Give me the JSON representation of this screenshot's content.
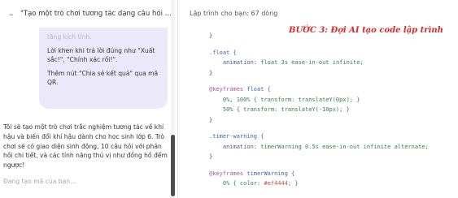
{
  "chat": {
    "title": "\"Tạo một trò chơi tương tác dạng câu hỏi trắc nghiệ...",
    "bubble": {
      "faded_line": "tăng kịch tính.",
      "p1": "Lời khen khi trả lời đúng như \"Xuất sắc!\", \"Chính xác rồi!\".",
      "p2": "Thêm nút \"Chia sẻ kết quả\" qua mã QR."
    },
    "answer": "Tôi sẽ tạo một trò chơi trắc nghiệm tương tác về khí hậu và biến đổi khí hậu dành cho học sinh lớp 6. Trò chơi sẽ có giao diện sinh động, 10 câu hỏi với phản hồi chi tiết, và các tính năng thú vị như đồng hồ đếm ngược!",
    "generating": "Đang tạo mã của bạn..."
  },
  "code_panel": {
    "header": "Lập trình cho bạn: 67 dòng",
    "overlay_title": "BƯỚC 3: Đợi AI tạo code lập trình",
    "lines": {
      "l0": "}",
      "l1": ".float {",
      "l2_prop": "animation",
      "l2_val": "float 3s ease-in-out infinite;",
      "l3": "}",
      "l4_kw": "@keyframes",
      "l4_name": "float {",
      "l5": "0%, 100% { transform: translateY(0px); }",
      "l6": "50% { transform: translateY(-10px); }",
      "l7": "}",
      "l8": ".timer-warning {",
      "l9_prop": "animation",
      "l9_val": "timerWarning 0.5s ease-in-out infinite alternate;",
      "l10": "}",
      "l11_kw": "@keyframes",
      "l11_name": "timerWarning {",
      "l12_head": "0% { color: ",
      "l12_val": "#ef4444",
      "l12_tail": "; }"
    }
  }
}
